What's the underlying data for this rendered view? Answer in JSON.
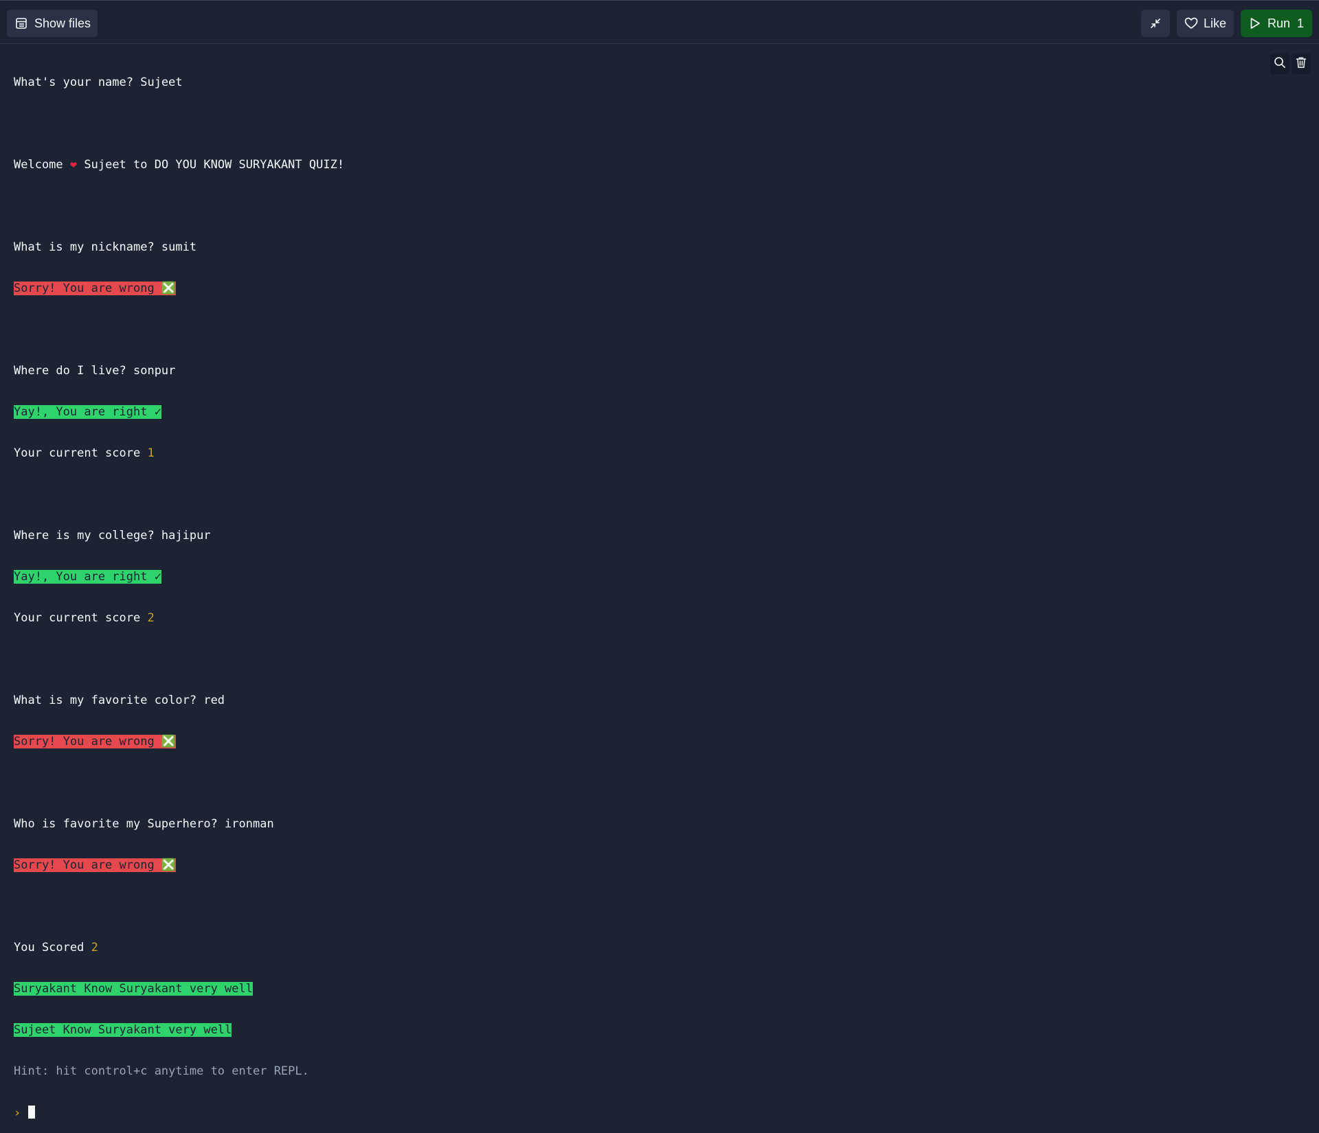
{
  "toolbar": {
    "show_files_label": "Show files",
    "like_label": "Like",
    "run_label": "Run",
    "run_count": "1"
  },
  "icons": {
    "files": "files-icon",
    "collapse": "collapse-icon",
    "like": "heart-outline-icon",
    "run": "play-icon",
    "search": "search-icon",
    "clear": "trash-icon"
  },
  "colors": {
    "background": "#1c2333",
    "run_button": "#0f5c1f",
    "wrong_bg": "#e5484d",
    "right_bg": "#2fd36b",
    "number": "#c9a227"
  },
  "console": {
    "name_prompt": "What's your name? Sujeet",
    "welcome_pre": "Welcome ",
    "welcome_heart": "❤",
    "welcome_post": " Sujeet to DO YOU KNOW SURYAKANT QUIZ!",
    "q1": "What is my nickname? sumit",
    "q1_result": "Sorry! You are wrong ❎",
    "q2": "Where do I live? sonpur",
    "q2_result": "Yay!, You are right ✓",
    "score_label_1": "Your current score ",
    "score_value_1": "1",
    "q3": "Where is my college? hajipur",
    "q3_result": "Yay!, You are right ✓",
    "score_label_2": "Your current score ",
    "score_value_2": "2",
    "q4": "What is my favorite color? red",
    "q4_result": "Sorry! You are wrong ❎",
    "q5": "Who is favorite my Superhero? ironman",
    "q5_result": "Sorry! You are wrong ❎",
    "final_label": "You Scored ",
    "final_value": "2",
    "verdict_1": "Suryakant Know Suryakant very well",
    "verdict_2": "Sujeet Know Suryakant very well",
    "hint": "Hint: hit control+c anytime to enter REPL.",
    "prompt_symbol": "›"
  }
}
